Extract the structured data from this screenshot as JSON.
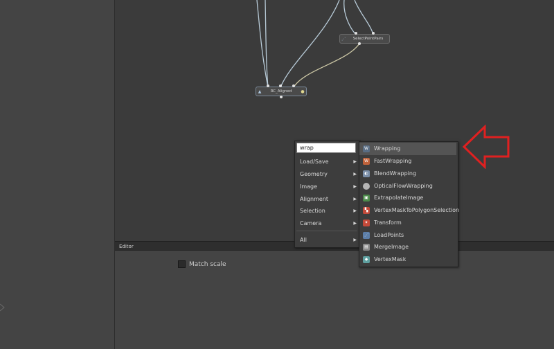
{
  "nodes": {
    "select_point_pairs": "SelectPointPairs",
    "rc_aligned": "RC_Aligned"
  },
  "editor": {
    "title": "Editor",
    "match_scale_label": "Match scale"
  },
  "search": {
    "value": "wrap"
  },
  "categories": [
    {
      "label": "Load/Save"
    },
    {
      "label": "Geometry"
    },
    {
      "label": "Image"
    },
    {
      "label": "Alignment"
    },
    {
      "label": "Selection"
    },
    {
      "label": "Camera"
    },
    {
      "label": "All"
    }
  ],
  "results": [
    {
      "label": "Wrapping",
      "icon": "wrap-icon",
      "color": "#5a6e85"
    },
    {
      "label": "FastWrapping",
      "icon": "fast-wrap-icon",
      "color": "#c0623a"
    },
    {
      "label": "BlendWrapping",
      "icon": "blend-icon",
      "color": "#7a8ea8"
    },
    {
      "label": "OpticalFlowWrapping",
      "icon": "optical-flow-icon",
      "color": "#b5b5b5"
    },
    {
      "label": "ExtrapolateImage",
      "icon": "extrapolate-icon",
      "color": "#4c8a4a"
    },
    {
      "label": "VertexMaskToPolygonSelection",
      "icon": "vertex-mask-selection-icon",
      "color": "#c44a3a"
    },
    {
      "label": "Transform",
      "icon": "transform-icon",
      "color": "#c44a3a"
    },
    {
      "label": "LoadPoints",
      "icon": "load-points-icon",
      "color": "#5c7ea8"
    },
    {
      "label": "MergeImage",
      "icon": "merge-image-icon",
      "color": "#8a8a8a"
    },
    {
      "label": "VertexMask",
      "icon": "vertex-mask-icon",
      "color": "#5fa0a0"
    }
  ],
  "colors": {
    "annotation_arrow": "#e02020"
  }
}
